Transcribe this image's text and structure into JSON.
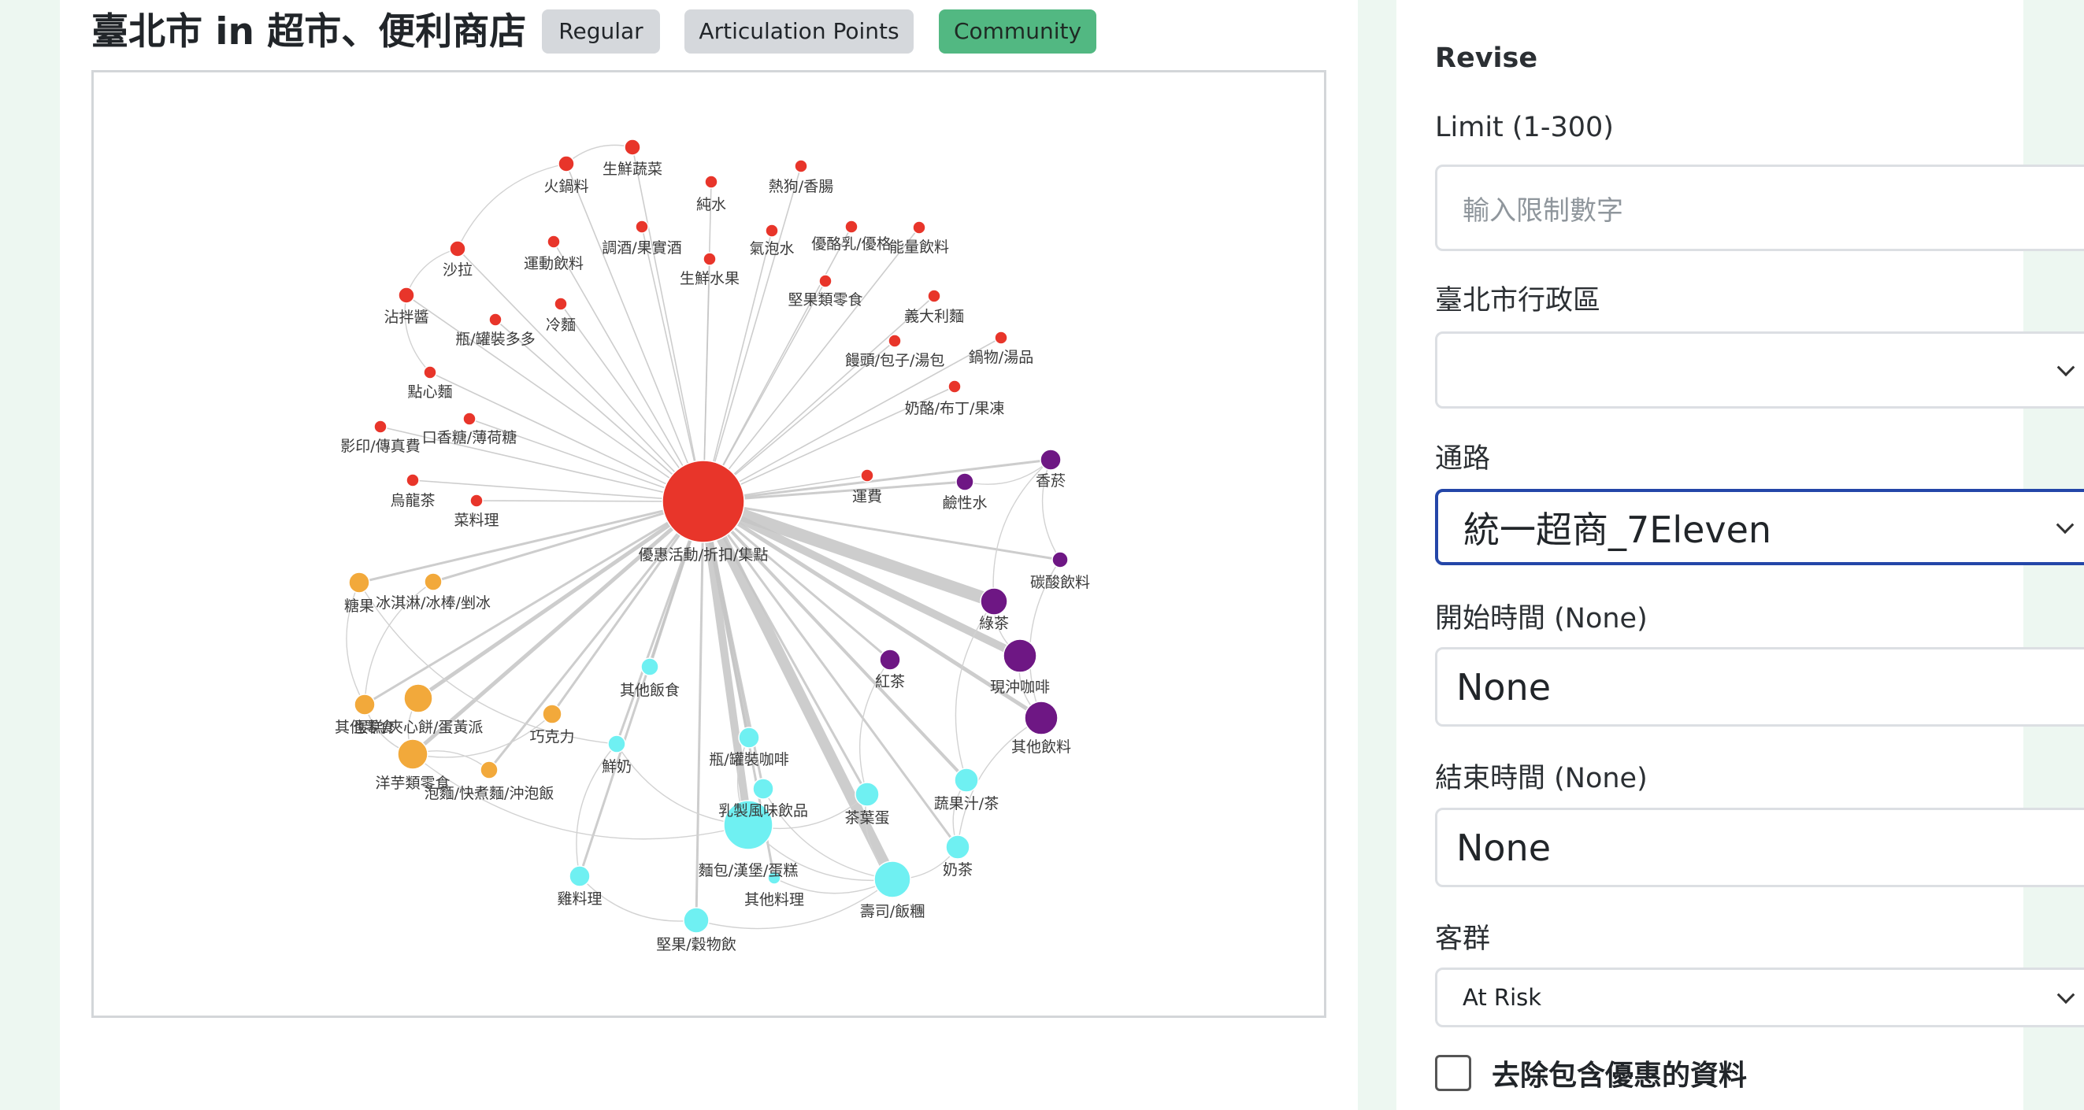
{
  "header": {
    "title": "臺北市 in 超市、便利商店",
    "tabs": [
      {
        "label": "Regular",
        "active": false
      },
      {
        "label": "Articulation Points",
        "active": false
      },
      {
        "label": "Community",
        "active": true
      }
    ]
  },
  "graph": {
    "community_colors": {
      "red": "#e8352a",
      "purple": "#6e1784",
      "orange": "#f2a93b",
      "cyan": "#6ff0f2"
    },
    "hub": "優惠活動/折扣/集點",
    "nodes": [
      {
        "label": "優惠活動/折扣/集點",
        "community": "red"
      },
      {
        "label": "生鮮蔬菜",
        "community": "red"
      },
      {
        "label": "火鍋料",
        "community": "red"
      },
      {
        "label": "純水",
        "community": "red"
      },
      {
        "label": "熱狗/香腸",
        "community": "red"
      },
      {
        "label": "調酒/果實酒",
        "community": "red"
      },
      {
        "label": "氣泡水",
        "community": "red"
      },
      {
        "label": "優酪乳/優格",
        "community": "red"
      },
      {
        "label": "能量飲料",
        "community": "red"
      },
      {
        "label": "沙拉",
        "community": "red"
      },
      {
        "label": "運動飲料",
        "community": "red"
      },
      {
        "label": "生鮮水果",
        "community": "red"
      },
      {
        "label": "堅果類零食",
        "community": "red"
      },
      {
        "label": "沾拌醬",
        "community": "red"
      },
      {
        "label": "冷麵",
        "community": "red"
      },
      {
        "label": "瓶/罐裝多多",
        "community": "red"
      },
      {
        "label": "義大利麵",
        "community": "red"
      },
      {
        "label": "饅頭/包子/湯包",
        "community": "red"
      },
      {
        "label": "鍋物/湯品",
        "community": "red"
      },
      {
        "label": "點心麵",
        "community": "red"
      },
      {
        "label": "奶酪/布丁/果凍",
        "community": "red"
      },
      {
        "label": "口香糖/薄荷糖",
        "community": "red"
      },
      {
        "label": "影印/傳真費",
        "community": "red"
      },
      {
        "label": "烏龍茶",
        "community": "red"
      },
      {
        "label": "菜料理",
        "community": "red"
      },
      {
        "label": "運費",
        "community": "red"
      },
      {
        "label": "香菸",
        "community": "purple"
      },
      {
        "label": "鹼性水",
        "community": "purple"
      },
      {
        "label": "碳酸飲料",
        "community": "purple"
      },
      {
        "label": "綠茶",
        "community": "purple"
      },
      {
        "label": "紅茶",
        "community": "purple"
      },
      {
        "label": "現沖咖啡",
        "community": "purple"
      },
      {
        "label": "其他飲料",
        "community": "purple"
      },
      {
        "label": "糖果",
        "community": "orange"
      },
      {
        "label": "冰淇淋/冰棒/剉冰",
        "community": "orange"
      },
      {
        "label": "其他零食",
        "community": "orange"
      },
      {
        "label": "蛋糕/夾心餅/蛋黃派",
        "community": "orange"
      },
      {
        "label": "巧克力",
        "community": "orange"
      },
      {
        "label": "洋芋類零食",
        "community": "orange"
      },
      {
        "label": "泡麵/快煮麵/沖泡飯",
        "community": "orange"
      },
      {
        "label": "其他飯食",
        "community": "cyan"
      },
      {
        "label": "鮮奶",
        "community": "cyan"
      },
      {
        "label": "瓶/罐裝咖啡",
        "community": "cyan"
      },
      {
        "label": "乳製風味飲品",
        "community": "cyan"
      },
      {
        "label": "蔬果汁/茶",
        "community": "cyan"
      },
      {
        "label": "茶葉蛋",
        "community": "cyan"
      },
      {
        "label": "奶茶",
        "community": "cyan"
      },
      {
        "label": "麵包/漢堡/蛋糕",
        "community": "cyan"
      },
      {
        "label": "雞料理",
        "community": "cyan"
      },
      {
        "label": "其他料理",
        "community": "cyan"
      },
      {
        "label": "壽司/飯糰",
        "community": "cyan"
      },
      {
        "label": "堅果/穀物飲",
        "community": "cyan"
      }
    ]
  },
  "sidebar": {
    "section_title": "Revise",
    "limit": {
      "label": "Limit (1-300)",
      "placeholder": "輸入限制數字"
    },
    "district": {
      "label": "臺北市行政區",
      "value": ""
    },
    "channel": {
      "label": "通路",
      "value": "統一超商_7Eleven"
    },
    "start_time": {
      "label": "開始時間 (None)",
      "value": "None"
    },
    "end_time": {
      "label": "結束時間 (None)",
      "value": "None"
    },
    "customer_group": {
      "label": "客群",
      "value": "At Risk"
    },
    "exclude_discount": {
      "label": "去除包含優惠的資料",
      "checked": false
    }
  }
}
